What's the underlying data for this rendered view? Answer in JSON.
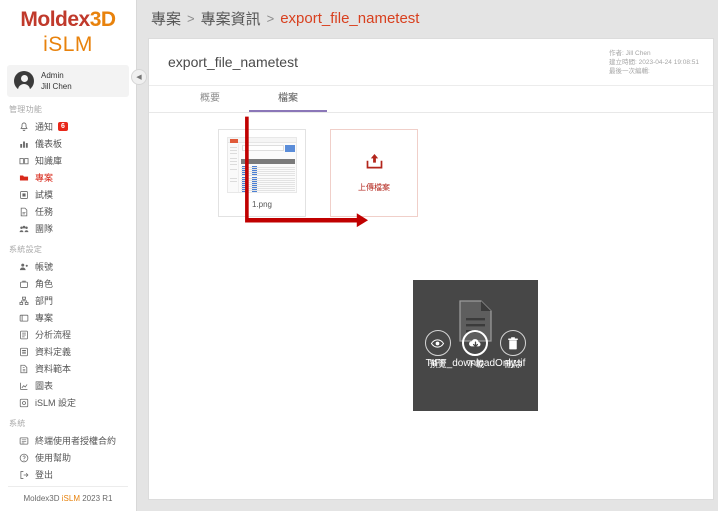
{
  "brand": {
    "name_main": "Moldex",
    "name_suffix": "3D",
    "product": "iSLM",
    "footer_prefix": "Moldex3D ",
    "footer_islm": "iSLM",
    "footer_version": " 2023 R1"
  },
  "user": {
    "role": "Admin",
    "name": "Jill Chen"
  },
  "sidebar": {
    "collapse_icon": "◀",
    "sections": [
      {
        "title": "管理功能",
        "items": [
          {
            "label": "通知",
            "icon": "bell-icon",
            "badge": "6",
            "active": false
          },
          {
            "label": "儀表板",
            "icon": "dashboard-icon",
            "badge": "",
            "active": false
          },
          {
            "label": "知識庫",
            "icon": "book-icon",
            "badge": "",
            "active": false
          },
          {
            "label": "專案",
            "icon": "folder-icon",
            "badge": "",
            "active": true
          },
          {
            "label": "試模",
            "icon": "mold-icon",
            "badge": "",
            "active": false
          },
          {
            "label": "任務",
            "icon": "task-icon",
            "badge": "",
            "active": false
          },
          {
            "label": "團隊",
            "icon": "team-icon",
            "badge": "",
            "active": false
          }
        ]
      },
      {
        "title": "系統設定",
        "items": [
          {
            "label": "帳號",
            "icon": "account-icon",
            "badge": "",
            "active": false
          },
          {
            "label": "角色",
            "icon": "role-icon",
            "badge": "",
            "active": false
          },
          {
            "label": "部門",
            "icon": "department-icon",
            "badge": "",
            "active": false
          },
          {
            "label": "專案",
            "icon": "project-settings-icon",
            "badge": "",
            "active": false
          },
          {
            "label": "分析流程",
            "icon": "workflow-icon",
            "badge": "",
            "active": false
          },
          {
            "label": "資料定義",
            "icon": "data-definition-icon",
            "badge": "",
            "active": false
          },
          {
            "label": "資料範本",
            "icon": "data-template-icon",
            "badge": "",
            "active": false
          },
          {
            "label": "圖表",
            "icon": "chart-icon",
            "badge": "",
            "active": false
          },
          {
            "label": "iSLM 設定",
            "icon": "islm-settings-icon",
            "badge": "",
            "active": false
          }
        ]
      },
      {
        "title": "系統",
        "items": [
          {
            "label": "終端使用者授權合約",
            "icon": "license-icon",
            "badge": "",
            "active": false
          },
          {
            "label": "使用幫助",
            "icon": "help-icon",
            "badge": "",
            "active": false
          },
          {
            "label": "登出",
            "icon": "logout-icon",
            "badge": "",
            "active": false
          }
        ]
      }
    ]
  },
  "breadcrumb": {
    "level1": "專案",
    "sep1": ">",
    "level2": "專案資訊",
    "sep2": ">",
    "current": "export_file_nametest"
  },
  "panel": {
    "title": "export_file_nametest",
    "meta": {
      "author": "作者: Jill Chen",
      "created": "建立時間: 2023-04-24 19:08:51",
      "edited": "最後一次編輯:"
    },
    "tabs": [
      {
        "label": "概要",
        "active": false
      },
      {
        "label": "檔案",
        "active": true
      }
    ],
    "files": [
      {
        "name": "1.png",
        "type": "image-thumbnail"
      }
    ],
    "upload": {
      "label": "上傳檔案",
      "icon": "upload-icon"
    },
    "hover_card": {
      "filename": "TIFF_downloadOnly.tif",
      "file_icon": "document-icon",
      "actions": [
        {
          "label": "預覽",
          "icon": "eye-icon",
          "highlight": false
        },
        {
          "label": "下載",
          "icon": "cloud-download-icon",
          "highlight": true
        },
        {
          "label": "刪除",
          "icon": "trash-icon",
          "highlight": false
        }
      ]
    }
  },
  "colors": {
    "brand_red": "#c0392b",
    "brand_orange": "#e8820c",
    "accent_red": "#d8281a",
    "tab_active": "#8b77b8",
    "annotation": "#c00000",
    "overlay_bg": "#474747"
  }
}
